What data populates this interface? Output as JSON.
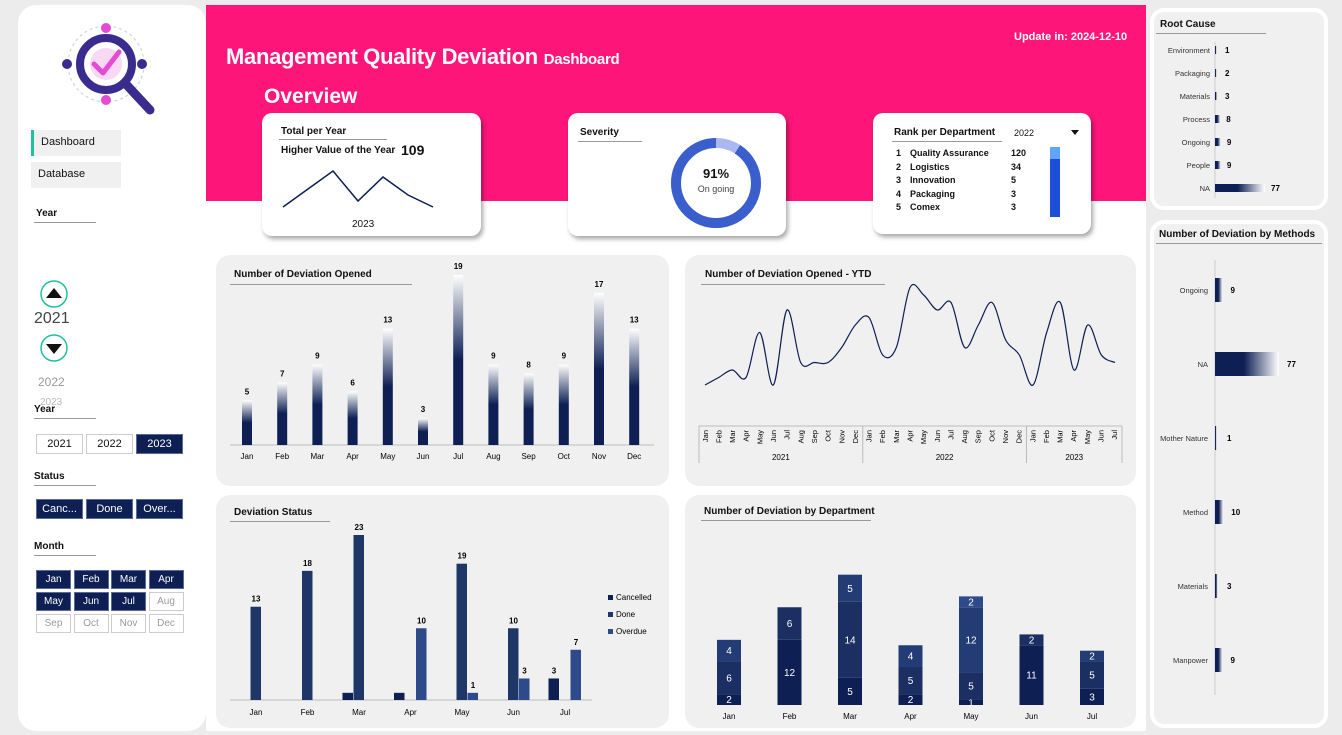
{
  "header": {
    "title": "Management Quality Deviation",
    "subtitle": "Dashboard",
    "overview": "Overview",
    "update": "Update in: 2024-12-10"
  },
  "nav": {
    "dashboard": "Dashboard",
    "database": "Database"
  },
  "year_picker": {
    "label": "Year",
    "current": "2021",
    "next": "2022",
    "next2": "2023"
  },
  "year_slicer": {
    "label": "Year",
    "items": [
      "2021",
      "2022",
      "2023"
    ],
    "selected": "2023"
  },
  "status_slicer": {
    "label": "Status",
    "items": [
      "Canc...",
      "Done",
      "Over..."
    ]
  },
  "month_slicer": {
    "label": "Month",
    "items": [
      "Jan",
      "Feb",
      "Mar",
      "Apr",
      "May",
      "Jun",
      "Jul",
      "Aug",
      "Sep",
      "Oct",
      "Nov",
      "Dec"
    ],
    "active_count": 7
  },
  "kpi_total": {
    "title": "Total per Year",
    "label": "Higher Value of the Year",
    "value": "109",
    "year": "2023",
    "spark": [
      2,
      5,
      8,
      3,
      7,
      4,
      2
    ]
  },
  "kpi_severity": {
    "title": "Severity",
    "value": "91%",
    "sub": "On going",
    "percent": 91
  },
  "kpi_rank": {
    "title": "Rank per Department",
    "year": "2022",
    "rows": [
      {
        "rank": "1",
        "name": "Quality Assurance",
        "value": "120"
      },
      {
        "rank": "2",
        "name": "Logistics",
        "value": "34"
      },
      {
        "rank": "3",
        "name": "Innovation",
        "value": "5"
      },
      {
        "rank": "4",
        "name": "Packaging",
        "value": "3"
      },
      {
        "rank": "5",
        "name": "Comex",
        "value": "3"
      }
    ]
  },
  "chart_data": [
    {
      "id": "opened",
      "type": "bar",
      "title": "Number of Deviation Opened",
      "categories": [
        "Jan",
        "Feb",
        "Mar",
        "Apr",
        "May",
        "Jun",
        "Jul",
        "Aug",
        "Sep",
        "Oct",
        "Nov",
        "Dec"
      ],
      "values": [
        5,
        7,
        9,
        6,
        13,
        3,
        19,
        9,
        8,
        9,
        17,
        13
      ],
      "ylim": [
        0,
        19
      ]
    },
    {
      "id": "ytd",
      "type": "line",
      "title": "Number of Deviation Opened - YTD",
      "categories": [
        "Jan",
        "Feb",
        "Mar",
        "Apr",
        "May",
        "Jun",
        "Jul",
        "Aug",
        "Sep",
        "Oct",
        "Nov",
        "Dec",
        "Jan",
        "Feb",
        "Mar",
        "Apr",
        "May",
        "Jun",
        "Jul",
        "Aug",
        "Sep",
        "Oct",
        "Nov",
        "Dec",
        "Jan",
        "Feb",
        "Mar",
        "Apr",
        "May",
        "Jun",
        "Jul"
      ],
      "groups": [
        "2021",
        "2022",
        "2023"
      ],
      "values": [
        4,
        5,
        6,
        5,
        11,
        4,
        14,
        7,
        7,
        7,
        9,
        12,
        13,
        8,
        9,
        17,
        16,
        14,
        15,
        9,
        12,
        15,
        10,
        8,
        4,
        11,
        15,
        6,
        12,
        8,
        7
      ]
    },
    {
      "id": "status",
      "type": "bar",
      "title": "Deviation Status",
      "categories": [
        "Jan",
        "Feb",
        "Mar",
        "Apr",
        "May",
        "Jun",
        "Jul"
      ],
      "series": [
        {
          "name": "Cancelled",
          "values": [
            0,
            0,
            1,
            1,
            0,
            0,
            3
          ]
        },
        {
          "name": "Done",
          "values": [
            13,
            18,
            23,
            0,
            19,
            10,
            0
          ]
        },
        {
          "name": "Overdue",
          "values": [
            0,
            0,
            0,
            10,
            1,
            3,
            7
          ]
        }
      ],
      "labels": [
        [
          null,
          "13",
          null
        ],
        [
          null,
          "18",
          null
        ],
        [
          null,
          "23",
          null
        ],
        [
          null,
          null,
          "10"
        ],
        [
          null,
          "19",
          "1"
        ],
        [
          null,
          "10",
          "3"
        ],
        [
          "3",
          null,
          "7"
        ]
      ],
      "ylim": [
        0,
        23
      ]
    },
    {
      "id": "department",
      "type": "bar",
      "title": "Number of Deviation by Department",
      "categories": [
        "Jan",
        "Feb",
        "Mar",
        "Apr",
        "May",
        "Jun",
        "Jul"
      ],
      "stacks": [
        [
          2,
          6,
          4
        ],
        [
          12,
          6
        ],
        [
          5,
          14,
          5
        ],
        [
          2,
          5,
          4
        ],
        [
          1,
          5,
          12,
          2
        ],
        [
          11,
          2
        ],
        [
          3,
          5,
          2
        ]
      ]
    },
    {
      "id": "rootcause",
      "type": "bar",
      "title": "Root Cause",
      "categories": [
        "Environment",
        "Packaging",
        "Materials",
        "Process",
        "Ongoing",
        "People",
        "NA"
      ],
      "values": [
        1,
        2,
        3,
        8,
        9,
        9,
        77
      ]
    },
    {
      "id": "methods",
      "type": "bar",
      "title": "Number of Deviation by Methods",
      "categories": [
        "Ongoing",
        "NA",
        "Mother Nature",
        "Method",
        "Materials",
        "Manpower"
      ],
      "values": [
        9,
        77,
        1,
        10,
        3,
        9
      ]
    }
  ],
  "colors": {
    "pink": "#fe157a",
    "navy": "#0d1f53",
    "blue": "#3a5fcd",
    "donut_light": "#aab8ef"
  }
}
